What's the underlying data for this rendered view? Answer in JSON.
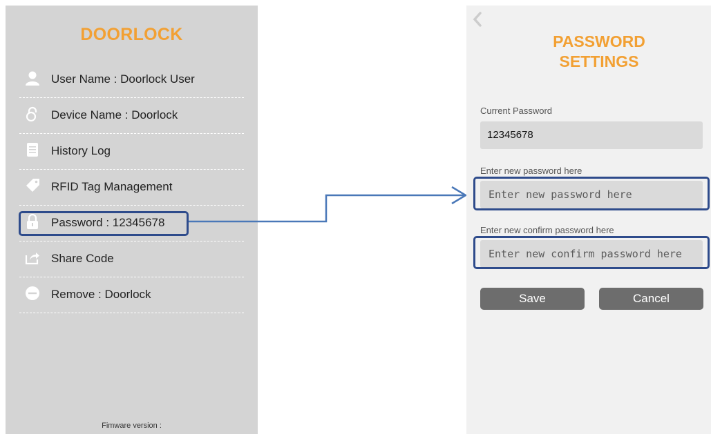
{
  "left_screen": {
    "title": "DOORLOCK",
    "menu": [
      {
        "label": "User Name : Doorlock User",
        "icon": "user-icon"
      },
      {
        "label": "Device Name : Doorlock",
        "icon": "lock-icon"
      },
      {
        "label": "History Log",
        "icon": "list-icon"
      },
      {
        "label": "RFID Tag Management",
        "icon": "tag-icon"
      },
      {
        "label": "Password : 12345678",
        "icon": "padlock-icon"
      },
      {
        "label": "Share Code",
        "icon": "share-icon"
      },
      {
        "label": "Remove : Doorlock",
        "icon": "minus-circle-icon"
      }
    ],
    "firmware_label": "Fimware version :"
  },
  "right_screen": {
    "title_line1": "PASSWORD",
    "title_line2": "SETTINGS",
    "current_password": {
      "label": "Current Password",
      "value": "12345678"
    },
    "new_password": {
      "label": "Enter new password here",
      "placeholder": "Enter new password here",
      "value": ""
    },
    "confirm_password": {
      "label": "Enter new confirm password here",
      "placeholder": "Enter new confirm password here",
      "value": ""
    },
    "save_label": "Save",
    "cancel_label": "Cancel"
  },
  "colors": {
    "accent_orange": "#f2a033",
    "highlight_blue": "#2e4b8b",
    "connector_blue": "#4a78b8",
    "left_bg": "#d4d4d4",
    "right_bg": "#f1f1f1",
    "button_gray": "#6d6d6d"
  }
}
